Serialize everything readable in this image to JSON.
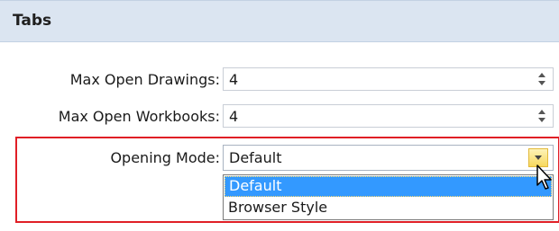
{
  "section": {
    "title": "Tabs"
  },
  "fields": {
    "max_open_drawings": {
      "label": "Max Open Drawings:",
      "value": "4"
    },
    "max_open_workbooks": {
      "label": "Max Open Workbooks:",
      "value": "4"
    },
    "opening_mode": {
      "label": "Opening Mode:",
      "value": "Default",
      "options": [
        "Default",
        "Browser Style"
      ],
      "highlighted_option": "Default"
    }
  },
  "colors": {
    "header_bg": "#dbe5f1",
    "highlight_border": "#e01f26",
    "selection_bg": "#3399ff"
  },
  "icons": {
    "spinner": "spinner-arrows-icon",
    "dropdown": "chevron-down-icon",
    "cursor": "mouse-pointer-icon"
  }
}
